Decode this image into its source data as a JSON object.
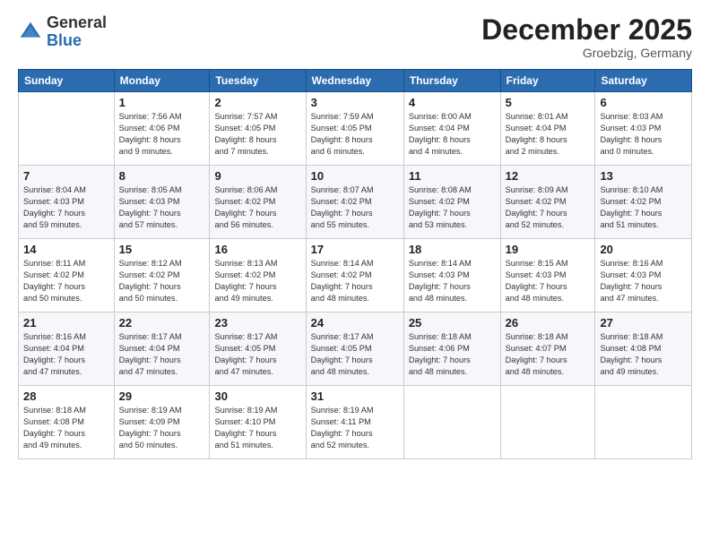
{
  "logo": {
    "general": "General",
    "blue": "Blue"
  },
  "header": {
    "month": "December 2025",
    "location": "Groebzig, Germany"
  },
  "weekdays": [
    "Sunday",
    "Monday",
    "Tuesday",
    "Wednesday",
    "Thursday",
    "Friday",
    "Saturday"
  ],
  "weeks": [
    [
      {
        "day": "",
        "info": ""
      },
      {
        "day": "1",
        "info": "Sunrise: 7:56 AM\nSunset: 4:06 PM\nDaylight: 8 hours\nand 9 minutes."
      },
      {
        "day": "2",
        "info": "Sunrise: 7:57 AM\nSunset: 4:05 PM\nDaylight: 8 hours\nand 7 minutes."
      },
      {
        "day": "3",
        "info": "Sunrise: 7:59 AM\nSunset: 4:05 PM\nDaylight: 8 hours\nand 6 minutes."
      },
      {
        "day": "4",
        "info": "Sunrise: 8:00 AM\nSunset: 4:04 PM\nDaylight: 8 hours\nand 4 minutes."
      },
      {
        "day": "5",
        "info": "Sunrise: 8:01 AM\nSunset: 4:04 PM\nDaylight: 8 hours\nand 2 minutes."
      },
      {
        "day": "6",
        "info": "Sunrise: 8:03 AM\nSunset: 4:03 PM\nDaylight: 8 hours\nand 0 minutes."
      }
    ],
    [
      {
        "day": "7",
        "info": "Sunrise: 8:04 AM\nSunset: 4:03 PM\nDaylight: 7 hours\nand 59 minutes."
      },
      {
        "day": "8",
        "info": "Sunrise: 8:05 AM\nSunset: 4:03 PM\nDaylight: 7 hours\nand 57 minutes."
      },
      {
        "day": "9",
        "info": "Sunrise: 8:06 AM\nSunset: 4:02 PM\nDaylight: 7 hours\nand 56 minutes."
      },
      {
        "day": "10",
        "info": "Sunrise: 8:07 AM\nSunset: 4:02 PM\nDaylight: 7 hours\nand 55 minutes."
      },
      {
        "day": "11",
        "info": "Sunrise: 8:08 AM\nSunset: 4:02 PM\nDaylight: 7 hours\nand 53 minutes."
      },
      {
        "day": "12",
        "info": "Sunrise: 8:09 AM\nSunset: 4:02 PM\nDaylight: 7 hours\nand 52 minutes."
      },
      {
        "day": "13",
        "info": "Sunrise: 8:10 AM\nSunset: 4:02 PM\nDaylight: 7 hours\nand 51 minutes."
      }
    ],
    [
      {
        "day": "14",
        "info": "Sunrise: 8:11 AM\nSunset: 4:02 PM\nDaylight: 7 hours\nand 50 minutes."
      },
      {
        "day": "15",
        "info": "Sunrise: 8:12 AM\nSunset: 4:02 PM\nDaylight: 7 hours\nand 50 minutes."
      },
      {
        "day": "16",
        "info": "Sunrise: 8:13 AM\nSunset: 4:02 PM\nDaylight: 7 hours\nand 49 minutes."
      },
      {
        "day": "17",
        "info": "Sunrise: 8:14 AM\nSunset: 4:02 PM\nDaylight: 7 hours\nand 48 minutes."
      },
      {
        "day": "18",
        "info": "Sunrise: 8:14 AM\nSunset: 4:03 PM\nDaylight: 7 hours\nand 48 minutes."
      },
      {
        "day": "19",
        "info": "Sunrise: 8:15 AM\nSunset: 4:03 PM\nDaylight: 7 hours\nand 48 minutes."
      },
      {
        "day": "20",
        "info": "Sunrise: 8:16 AM\nSunset: 4:03 PM\nDaylight: 7 hours\nand 47 minutes."
      }
    ],
    [
      {
        "day": "21",
        "info": "Sunrise: 8:16 AM\nSunset: 4:04 PM\nDaylight: 7 hours\nand 47 minutes."
      },
      {
        "day": "22",
        "info": "Sunrise: 8:17 AM\nSunset: 4:04 PM\nDaylight: 7 hours\nand 47 minutes."
      },
      {
        "day": "23",
        "info": "Sunrise: 8:17 AM\nSunset: 4:05 PM\nDaylight: 7 hours\nand 47 minutes."
      },
      {
        "day": "24",
        "info": "Sunrise: 8:17 AM\nSunset: 4:05 PM\nDaylight: 7 hours\nand 48 minutes."
      },
      {
        "day": "25",
        "info": "Sunrise: 8:18 AM\nSunset: 4:06 PM\nDaylight: 7 hours\nand 48 minutes."
      },
      {
        "day": "26",
        "info": "Sunrise: 8:18 AM\nSunset: 4:07 PM\nDaylight: 7 hours\nand 48 minutes."
      },
      {
        "day": "27",
        "info": "Sunrise: 8:18 AM\nSunset: 4:08 PM\nDaylight: 7 hours\nand 49 minutes."
      }
    ],
    [
      {
        "day": "28",
        "info": "Sunrise: 8:18 AM\nSunset: 4:08 PM\nDaylight: 7 hours\nand 49 minutes."
      },
      {
        "day": "29",
        "info": "Sunrise: 8:19 AM\nSunset: 4:09 PM\nDaylight: 7 hours\nand 50 minutes."
      },
      {
        "day": "30",
        "info": "Sunrise: 8:19 AM\nSunset: 4:10 PM\nDaylight: 7 hours\nand 51 minutes."
      },
      {
        "day": "31",
        "info": "Sunrise: 8:19 AM\nSunset: 4:11 PM\nDaylight: 7 hours\nand 52 minutes."
      },
      {
        "day": "",
        "info": ""
      },
      {
        "day": "",
        "info": ""
      },
      {
        "day": "",
        "info": ""
      }
    ]
  ]
}
